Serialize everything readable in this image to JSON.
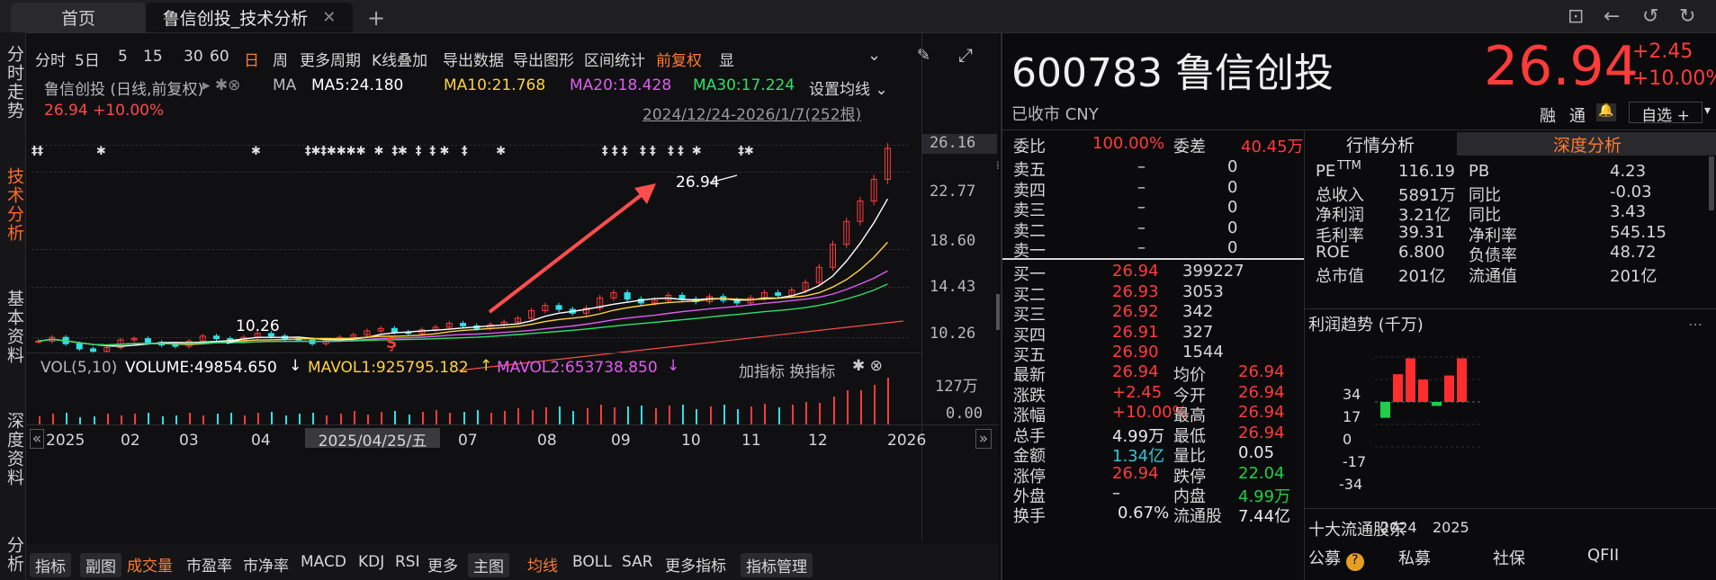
{
  "tabs": {
    "home": "首页",
    "active": "鲁信创投_技术分析",
    "close": "✕",
    "add": "+"
  },
  "window_icons": [
    "⊡",
    "←",
    "↺",
    "↻"
  ],
  "left_nav": [
    "分时走势",
    "技术分析",
    "基本资料",
    "深度资料",
    "分析"
  ],
  "toolbar": {
    "items": [
      "分时",
      "5日",
      "5",
      "15",
      "30",
      "60",
      "日",
      "周",
      "更多周期",
      "K线叠加",
      "导出数据",
      "导出图形",
      "区间统计",
      "前复权",
      "显"
    ],
    "active": "日"
  },
  "chart_header": {
    "name": "鲁信创投 (日线,前复权)",
    "ma_label": "MA",
    "ma5": "MA5:24.180",
    "ma10": "MA10:21.768",
    "ma20": "MA20:18.428",
    "ma30": "MA30:17.224",
    "settings": "设置均线",
    "price_line": "26.94 +10.00%",
    "range": "2024/12/24-2026/1/7(252根)"
  },
  "chart_data": {
    "type": "candlestick",
    "price_axis": [
      "26.16",
      "22.77",
      "18.60",
      "14.43",
      "10.26"
    ],
    "high_label": "26.94",
    "low_label": "10.26",
    "date_axis": [
      "2025",
      "02",
      "03",
      "04",
      "10",
      "11",
      "12",
      "2026"
    ],
    "cursor_date": "2025/04/25/五",
    "approx_close": [
      11.8,
      12.1,
      11.6,
      11.2,
      11.0,
      11.3,
      11.9,
      12.0,
      11.7,
      11.5,
      11.4,
      11.8,
      12.2,
      12.0,
      11.8,
      12.1,
      12.4,
      12.2,
      12.0,
      11.9,
      11.6,
      11.9,
      12.1,
      12.3,
      12.6,
      12.8,
      12.5,
      12.4,
      12.7,
      12.9,
      13.2,
      13.0,
      12.8,
      13.1,
      13.3,
      13.6,
      14.2,
      14.6,
      14.3,
      14.0,
      14.4,
      15.2,
      15.6,
      15.1,
      14.8,
      15.0,
      15.4,
      15.1,
      14.9,
      15.3,
      15.0,
      14.8,
      15.2,
      15.6,
      15.4,
      15.8,
      16.4,
      17.6,
      19.4,
      21.2,
      22.8,
      24.5,
      26.94
    ]
  },
  "volume": {
    "label": "VOL(5,10)",
    "volume": "VOLUME:49854.650",
    "mavol1": "MAVOL1:925795.182",
    "mavol2": "MAVOL2:653738.850",
    "actions": "加指标 换指标",
    "axis": [
      "127万",
      "0.00"
    ]
  },
  "bottom_tabs": [
    "指标",
    "副图",
    "成交量",
    "市盈率",
    "市净率",
    "MACD",
    "KDJ",
    "RSI",
    "更多",
    "主图",
    "均线",
    "BOLL",
    "SAR",
    "更多指标",
    "指标管理"
  ],
  "quote": {
    "code": "600783",
    "name": "鲁信创投",
    "price": "26.94",
    "change": "+2.45",
    "change_pct": "+10.00%",
    "status": "已收市 CNY",
    "tags": [
      "融",
      "通"
    ],
    "watch": "自选 +",
    "weibi": {
      "label": "委比",
      "value": "100.00%"
    },
    "weicha": {
      "label": "委差",
      "value": "40.45万"
    },
    "asks": [
      {
        "label": "卖五",
        "price": "–",
        "vol": "0"
      },
      {
        "label": "卖四",
        "price": "–",
        "vol": "0"
      },
      {
        "label": "卖三",
        "price": "–",
        "vol": "0"
      },
      {
        "label": "卖二",
        "price": "–",
        "vol": "0"
      },
      {
        "label": "卖一",
        "price": "–",
        "vol": "0"
      }
    ],
    "bids": [
      {
        "label": "买一",
        "price": "26.94",
        "vol": "399227"
      },
      {
        "label": "买二",
        "price": "26.93",
        "vol": "3053"
      },
      {
        "label": "买三",
        "price": "26.92",
        "vol": "342"
      },
      {
        "label": "买四",
        "price": "26.91",
        "vol": "327"
      },
      {
        "label": "买五",
        "price": "26.90",
        "vol": "1544"
      }
    ],
    "stats_left": [
      {
        "label": "最新",
        "value": "26.94",
        "color": "red"
      },
      {
        "label": "涨跌",
        "value": "+2.45",
        "color": "red"
      },
      {
        "label": "涨幅",
        "value": "+10.00%",
        "color": "red"
      },
      {
        "label": "总手",
        "value": "4.99万",
        "color": "white"
      },
      {
        "label": "金额",
        "value": "1.34亿",
        "color": "cyan"
      },
      {
        "label": "涨停",
        "value": "26.94",
        "color": "red"
      },
      {
        "label": "外盘",
        "value": "–",
        "color": "white"
      }
    ],
    "stats_right": [
      {
        "label": "均价",
        "value": "26.94",
        "color": "red"
      },
      {
        "label": "今开",
        "value": "26.94",
        "color": "red"
      },
      {
        "label": "最高",
        "value": "26.94",
        "color": "red"
      },
      {
        "label": "最低",
        "value": "26.94",
        "color": "red"
      },
      {
        "label": "量比",
        "value": "0.05",
        "color": "white"
      },
      {
        "label": "跌停",
        "value": "22.04",
        "color": "green"
      },
      {
        "label": "内盘",
        "value": "4.99万",
        "color": "green"
      }
    ],
    "partial_row": {
      "left": "换手",
      "lv": "0.67%",
      "right": "流通股",
      "rv": "7.44亿"
    }
  },
  "analysis": {
    "tab1": "行情分析",
    "tab2": "深度分析",
    "pe_label": "PE",
    "ttm": "TTM",
    "rows": [
      {
        "l1": "",
        "v1": "116.19",
        "l2": "PB",
        "v2": "4.23"
      },
      {
        "l1": "总收入",
        "v1": "5891万",
        "l2": "同比",
        "v2": "-0.03"
      },
      {
        "l1": "净利润",
        "v1": "3.21亿",
        "l2": "同比",
        "v2": "3.43"
      },
      {
        "l1": "毛利率",
        "v1": "39.31",
        "l2": "净利率",
        "v2": "545.15"
      },
      {
        "l1": "ROE",
        "v1": "6.800",
        "l2": "负债率",
        "v2": "48.72"
      },
      {
        "l1": "总市值",
        "v1": "201亿",
        "l2": "流通值",
        "v2": "201亿"
      }
    ]
  },
  "profit": {
    "title": "利润趋势 (千万)",
    "yaxis": [
      "34",
      "17",
      "0",
      "-17",
      "-34"
    ],
    "years": [
      "2024",
      "2025"
    ],
    "values_2024": [
      -12,
      21,
      33,
      17
    ],
    "values_2025": [
      -3,
      20,
      33
    ]
  },
  "holders": {
    "title": "十大流通股东",
    "cats": [
      "公募",
      "私募",
      "社保",
      "QFII"
    ]
  }
}
